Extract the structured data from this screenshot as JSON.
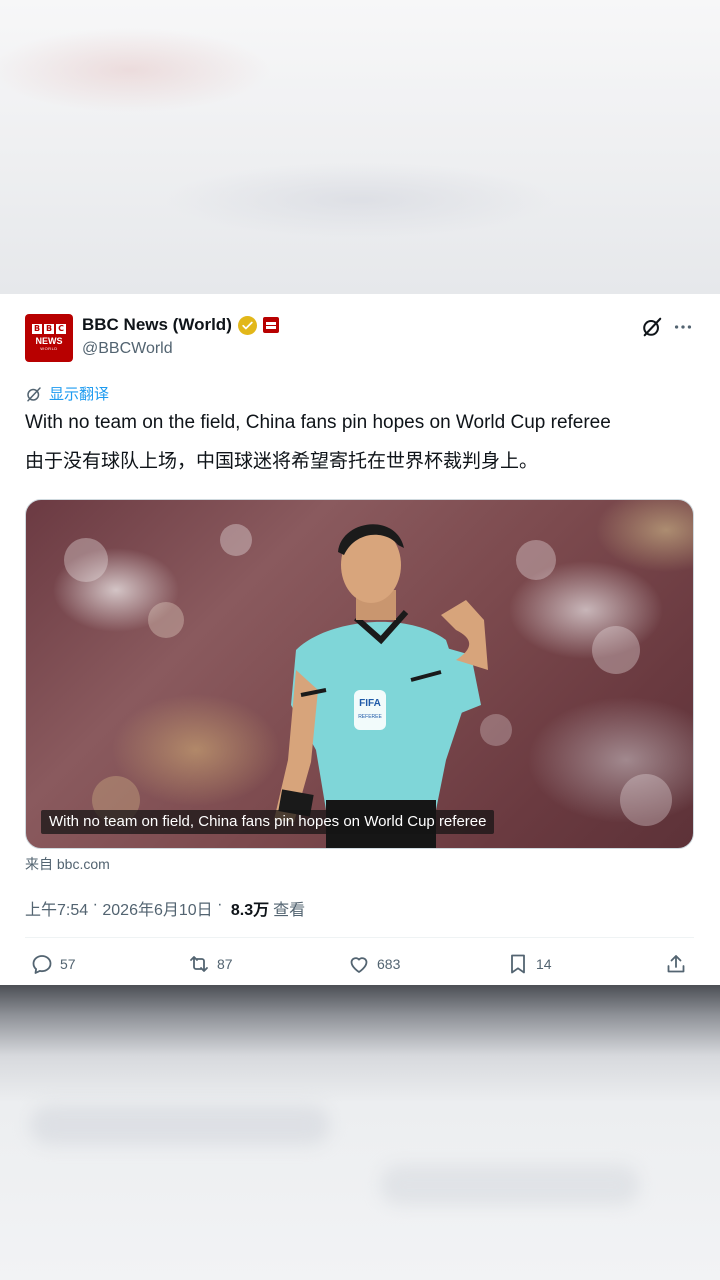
{
  "post": {
    "author": {
      "display_name": "BBC News (World)",
      "handle": "@BBCWorld",
      "avatar_letters": [
        "B",
        "B",
        "C"
      ],
      "avatar_line1": "NEWS",
      "avatar_line2": "WORLD",
      "verified_color": "#e2b719",
      "brand_color": "#b80000"
    },
    "translate_label": "显示翻译",
    "text_en": "With no team on the field, China fans pin hopes on World Cup referee",
    "text_zh": "由于没有球队上场，中国球迷将希望寄托在世界杯裁判身上。",
    "media": {
      "caption": "With no team on field, China fans pin hopes on World Cup referee",
      "jersey_text": "FIFA",
      "jersey_sub": "REFEREE"
    },
    "source": "来自 bbc.com",
    "time": "上午7:54",
    "separator1": " · ",
    "date": "2026年6月10日",
    "separator2": " · ",
    "views_count": "8.3万",
    "views_label": "查看",
    "actions": {
      "replies": "57",
      "reposts": "87",
      "likes": "683",
      "bookmarks": "14"
    },
    "accent_color": "#1d9bf0"
  }
}
